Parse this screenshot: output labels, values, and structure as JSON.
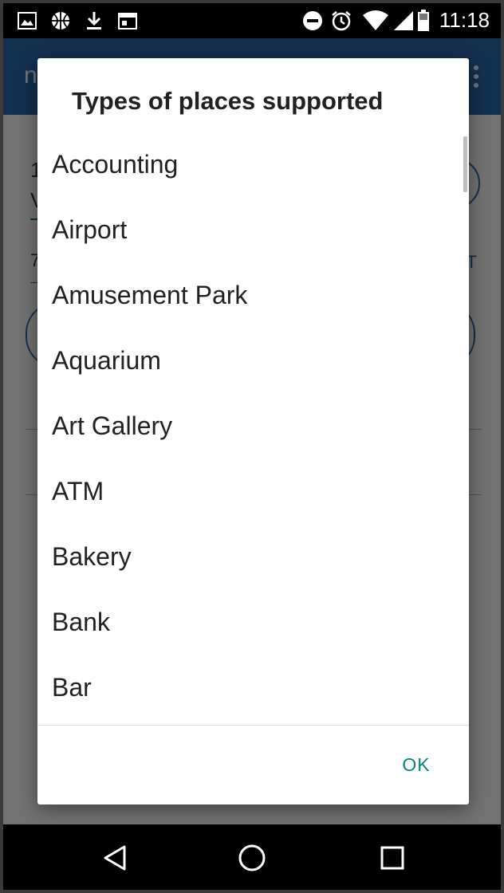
{
  "status_bar": {
    "time": "11:18",
    "left_icons": [
      "image-icon",
      "basketball-icon",
      "download-icon",
      "calendar-icon"
    ],
    "right_icons": [
      "do-not-disturb-icon",
      "alarm-icon",
      "wifi-icon",
      "signal-icon",
      "battery-icon"
    ]
  },
  "background_app": {
    "toolbar_title": "n",
    "field_1": "1",
    "field_2": "V",
    "field_3": "7",
    "right_text": "T",
    "colors": {
      "toolbar": "#2b6cb0",
      "accent": "#2e7d32"
    }
  },
  "dialog": {
    "title": "Types of places supported",
    "items": [
      "Accounting",
      "Airport",
      "Amusement Park",
      "Aquarium",
      "Art Gallery",
      "ATM",
      "Bakery",
      "Bank",
      "Bar"
    ],
    "ok_label": "OK",
    "ok_color": "#00897b"
  },
  "nav_bar": {
    "buttons": [
      "back-icon",
      "home-icon",
      "recents-icon"
    ]
  }
}
